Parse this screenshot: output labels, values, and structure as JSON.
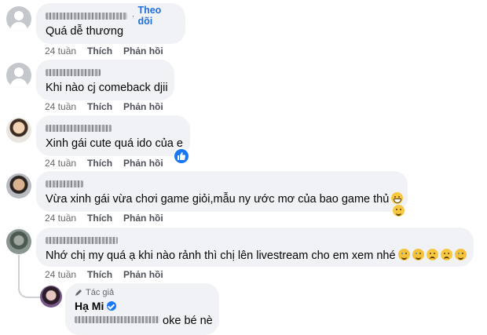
{
  "comments": [
    {
      "name": "",
      "follow": "Theo dõi",
      "text": "Quá dễ thương",
      "time": "24 tuần",
      "like": "Thích",
      "reply": "Phản hồi"
    },
    {
      "name": "",
      "text": "Khi nào cj comeback djii",
      "time": "24 tuần",
      "like": "Thích",
      "reply": "Phản hồi"
    },
    {
      "name": "",
      "text": "Xinh gái cute quá ido của e",
      "time": "24 tuần",
      "like": "Thích",
      "reply": "Phản hồi",
      "reaction": "like-icon"
    },
    {
      "name": "",
      "text": "Vừa xinh gái vừa chơi game giỏi,mẫu ny ước mơ của bao game thủ",
      "time": "24 tuần",
      "like": "Thích",
      "reply": "Phản hồi",
      "emojis": [
        "grin-emoji",
        "laugh-emoji"
      ]
    },
    {
      "name": "",
      "text": "Nhớ chị my quá ạ khi nào rảnh thì chị lên livestream cho em xem nhé",
      "time": "24 tuần",
      "like": "Thích",
      "reply": "Phản hồi",
      "emojis": [
        "crying-emoji",
        "crying-emoji",
        "sad-emoji",
        "sad-emoji",
        "crying-emoji"
      ]
    }
  ],
  "reply": {
    "author_tag": "Tác giả",
    "name": "Hạ Mi",
    "verified": true,
    "text": "oke bé nè"
  },
  "colors": {
    "bubble": "#f0f2f5",
    "link": "#216fdb",
    "like_badge": "#1877f2",
    "meta": "#65676b"
  }
}
